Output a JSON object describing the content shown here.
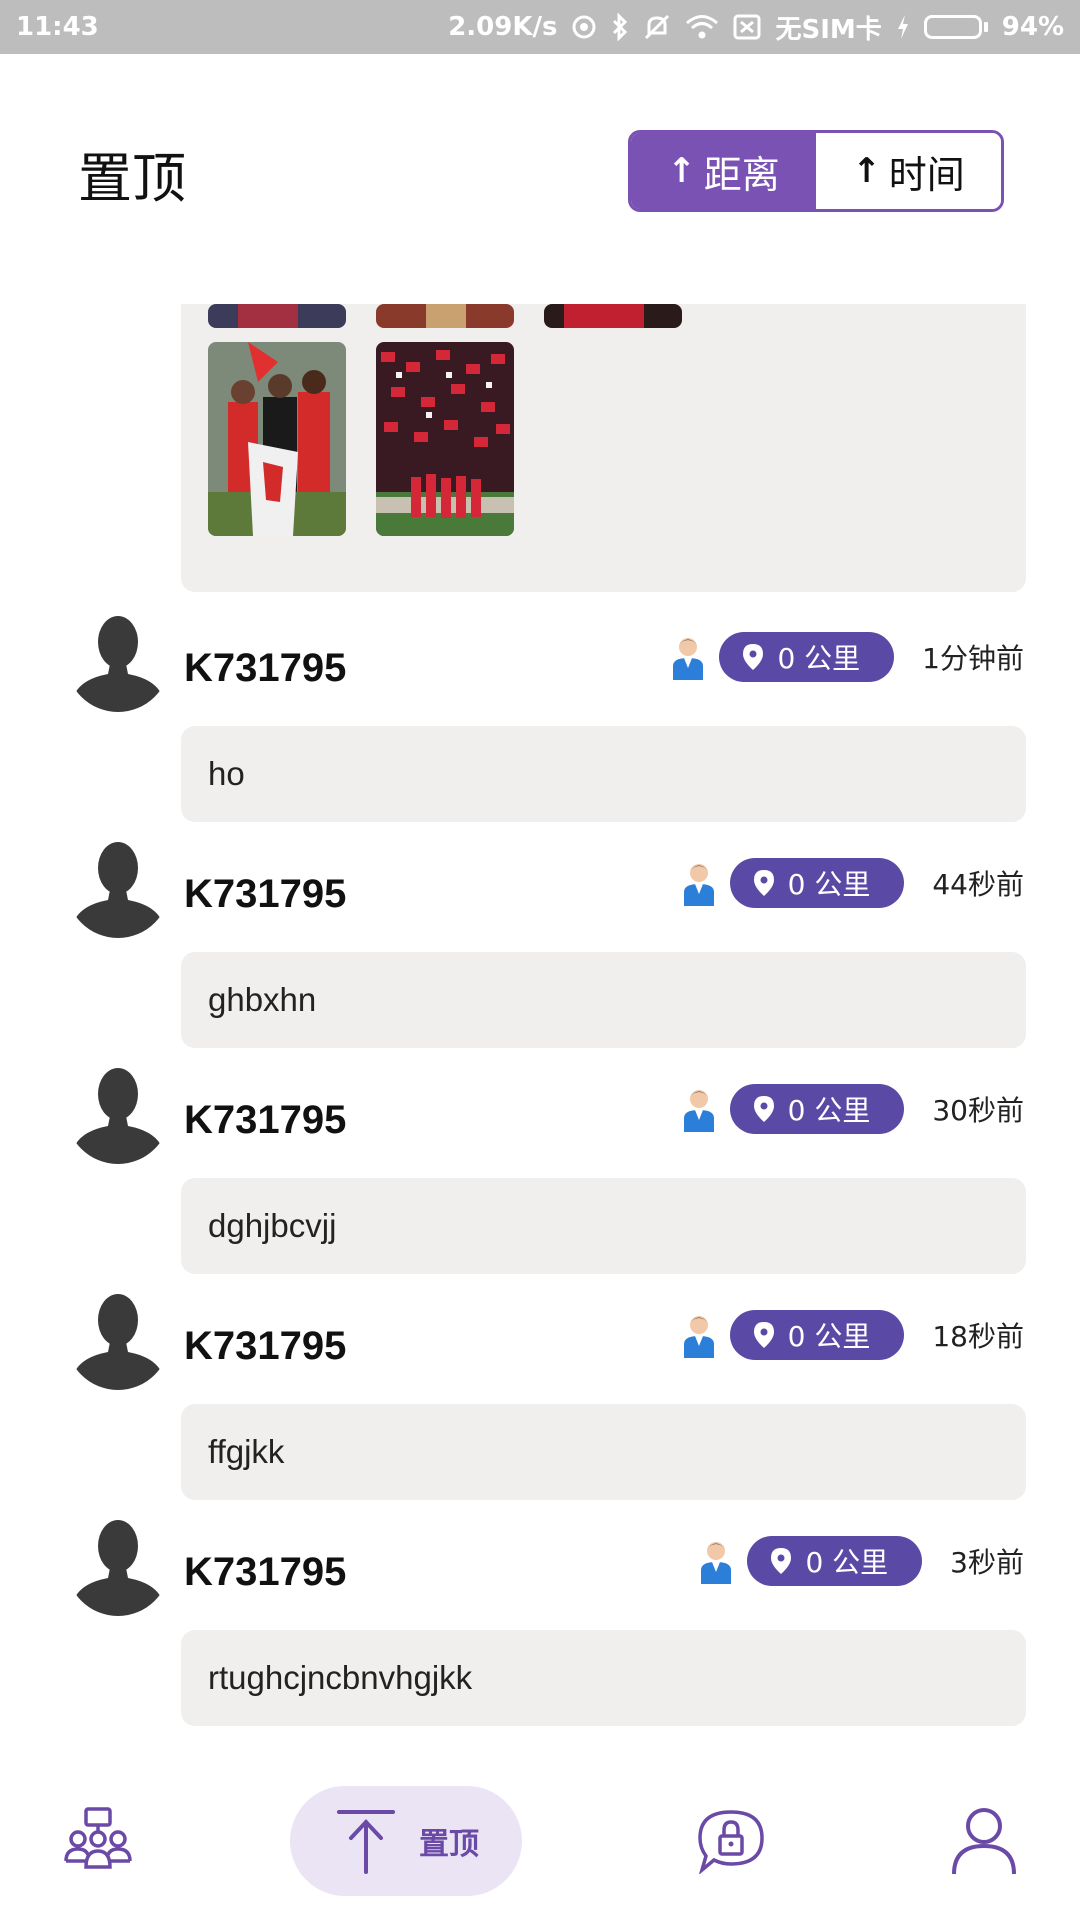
{
  "status_bar": {
    "time": "11:43",
    "net_speed": "2.09K/s",
    "sim": "无SIM卡",
    "battery": "94%",
    "battery_level": 0.94
  },
  "header": {
    "title": "置顶",
    "sort": {
      "distance_label": "距离",
      "time_label": "时间",
      "active": "distance"
    }
  },
  "posts": [
    {
      "username": "K731795",
      "distance": "0 公里",
      "time": "1分钟前",
      "text": "ho"
    },
    {
      "username": "K731795",
      "distance": "0 公里",
      "time": "44秒前",
      "text": "ghbxhn"
    },
    {
      "username": "K731795",
      "distance": "0 公里",
      "time": "30秒前",
      "text": "dghjbcvjj"
    },
    {
      "username": "K731795",
      "distance": "0 公里",
      "time": "18秒前",
      "text": "ffgjkk"
    },
    {
      "username": "K731795",
      "distance": "0 公里",
      "time": "3秒前",
      "text": "rtughcjncbnvhgjkk"
    }
  ],
  "bottom_nav": {
    "items": [
      {
        "icon": "group-icon"
      },
      {
        "icon": "pin-top-icon",
        "label": "置顶"
      },
      {
        "icon": "lock-chat-icon"
      },
      {
        "icon": "profile-icon"
      }
    ]
  },
  "colors": {
    "accent": "#7a52b3",
    "badge": "#5a4aa6",
    "card_bg": "#f0efee",
    "status_bar": "#bdbdbd"
  }
}
